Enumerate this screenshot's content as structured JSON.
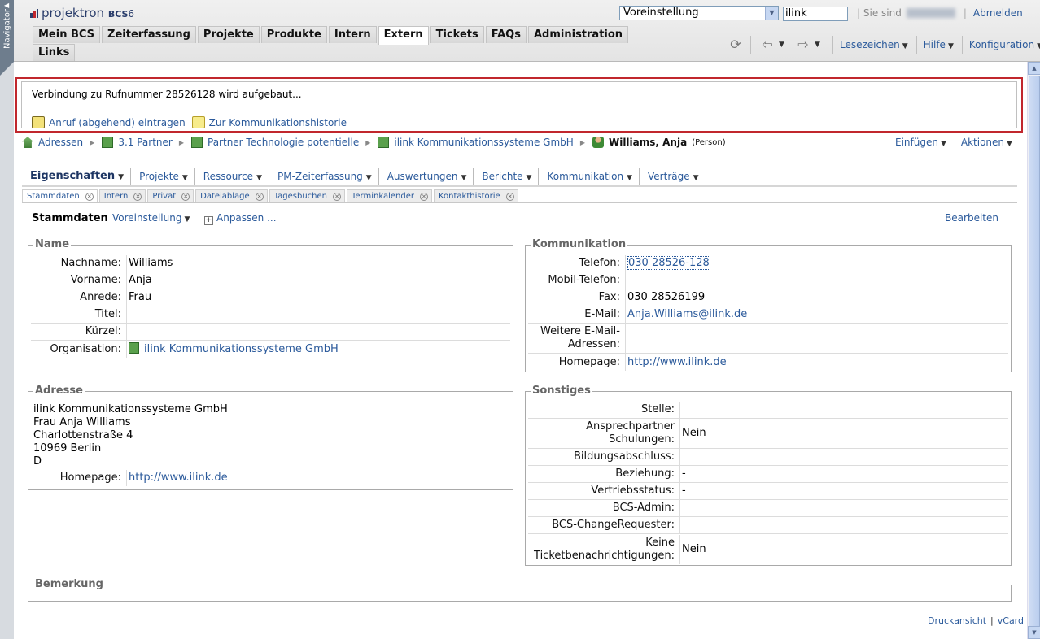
{
  "navigator": {
    "label": "Navigator"
  },
  "header": {
    "logo_text": "projektron",
    "logo_sub": "BCS",
    "logo_version": "6",
    "preset_select": "Voreinstellung",
    "search_value": "ilink",
    "logged_in_prefix": "Sie sind",
    "logout": "Abmelden"
  },
  "main_tabs_row1": [
    {
      "label": "Mein BCS"
    },
    {
      "label": "Zeiterfassung"
    },
    {
      "label": "Projekte"
    },
    {
      "label": "Produkte"
    },
    {
      "label": "Intern"
    },
    {
      "label": "Extern"
    },
    {
      "label": "Tickets"
    },
    {
      "label": "FAQs"
    },
    {
      "label": "Administration"
    }
  ],
  "main_tabs_row2": [
    {
      "label": "Links"
    }
  ],
  "toolbar": {
    "bookmarks": "Lesezeichen",
    "help": "Hilfe",
    "config": "Konfiguration"
  },
  "call_box": {
    "message": "Verbindung zu Rufnummer 28526128 wird aufgebaut...",
    "action_log_call": "Anruf (abgehend) eintragen",
    "action_history": "Zur Kommunikationshistorie"
  },
  "breadcrumb": {
    "items": [
      "Adressen",
      "3.1 Partner",
      "Partner Technologie potentielle",
      "ilink Kommunikationssysteme GmbH"
    ],
    "current": "Williams, Anja",
    "current_type": "(Person)",
    "insert": "Einfügen",
    "actions": "Aktionen"
  },
  "object_tabs": [
    "Eigenschaften",
    "Projekte",
    "Ressource",
    "PM-Zeiterfassung",
    "Auswertungen",
    "Berichte",
    "Kommunikation",
    "Verträge"
  ],
  "sub_tabs": [
    "Stammdaten",
    "Intern",
    "Privat",
    "Dateiablage",
    "Tagesbuchen",
    "Terminkalender",
    "Kontakthistorie"
  ],
  "content_bar": {
    "title": "Stammdaten",
    "preset": "Voreinstellung",
    "adjust": "Anpassen ...",
    "edit": "Bearbeiten"
  },
  "name_box": {
    "legend": "Name",
    "rows": [
      {
        "label": "Nachname:",
        "value": "Williams"
      },
      {
        "label": "Vorname:",
        "value": "Anja"
      },
      {
        "label": "Anrede:",
        "value": "Frau"
      },
      {
        "label": "Titel:",
        "value": ""
      },
      {
        "label": "Kürzel:",
        "value": ""
      },
      {
        "label": "Organisation:",
        "value": "ilink Kommunikationssysteme GmbH"
      }
    ]
  },
  "comm_box": {
    "legend": "Kommunikation",
    "rows": [
      {
        "label": "Telefon:",
        "value": "030 28526-128"
      },
      {
        "label": "Mobil-Telefon:",
        "value": ""
      },
      {
        "label": "Fax:",
        "value": "030 28526199"
      },
      {
        "label": "E-Mail:",
        "value": "Anja.Williams@ilink.de"
      },
      {
        "label": "Weitere E-Mail-Adressen:",
        "value": ""
      },
      {
        "label": "Homepage:",
        "value": "http://www.ilink.de"
      }
    ]
  },
  "address_box": {
    "legend": "Adresse",
    "lines": [
      "ilink Kommunikationssysteme GmbH",
      "Frau Anja Williams",
      "Charlottenstraße 4",
      "10969 Berlin",
      "D"
    ],
    "homepage_label": "Homepage:",
    "homepage_value": "http://www.ilink.de"
  },
  "misc_box": {
    "legend": "Sonstiges",
    "rows": [
      {
        "label": "Stelle:",
        "value": ""
      },
      {
        "label": "Ansprechpartner Schulungen:",
        "value": "Nein"
      },
      {
        "label": "Bildungsabschluss:",
        "value": ""
      },
      {
        "label": "Beziehung:",
        "value": "-"
      },
      {
        "label": "Vertriebsstatus:",
        "value": "-"
      },
      {
        "label": "BCS-Admin:",
        "value": ""
      },
      {
        "label": "BCS-ChangeRequester:",
        "value": ""
      },
      {
        "label": "Keine Ticketbenachrichtigungen:",
        "value": "Nein"
      }
    ]
  },
  "note_box": {
    "legend": "Bemerkung"
  },
  "footer": {
    "print": "Druckansicht",
    "vcard": "vCard"
  }
}
